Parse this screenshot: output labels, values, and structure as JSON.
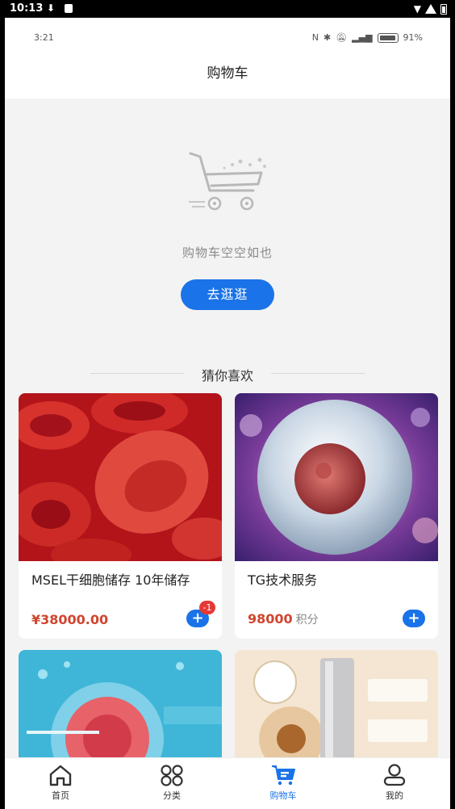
{
  "system": {
    "time": "10:13"
  },
  "inner_status": {
    "time": "3:21",
    "battery": "91%"
  },
  "header": {
    "title": "购物车"
  },
  "empty": {
    "text": "购物车空空如也",
    "button_label": "去逛逛"
  },
  "recommend": {
    "title": "猜你喜欢"
  },
  "products": [
    {
      "name": "MSEL干细胞储存 10年储存",
      "price": "¥38000.00",
      "unit": "",
      "badge": "-1"
    },
    {
      "name": "TG技术服务",
      "price": "98000",
      "unit": "积分",
      "badge": ""
    }
  ],
  "tabs": [
    {
      "label": "首页",
      "icon": "home-icon"
    },
    {
      "label": "分类",
      "icon": "category-icon"
    },
    {
      "label": "购物车",
      "icon": "cart-icon"
    },
    {
      "label": "我的",
      "icon": "user-icon"
    }
  ],
  "colors": {
    "accent": "#1a73e8",
    "price": "#d0452e",
    "badge": "#e53935"
  }
}
